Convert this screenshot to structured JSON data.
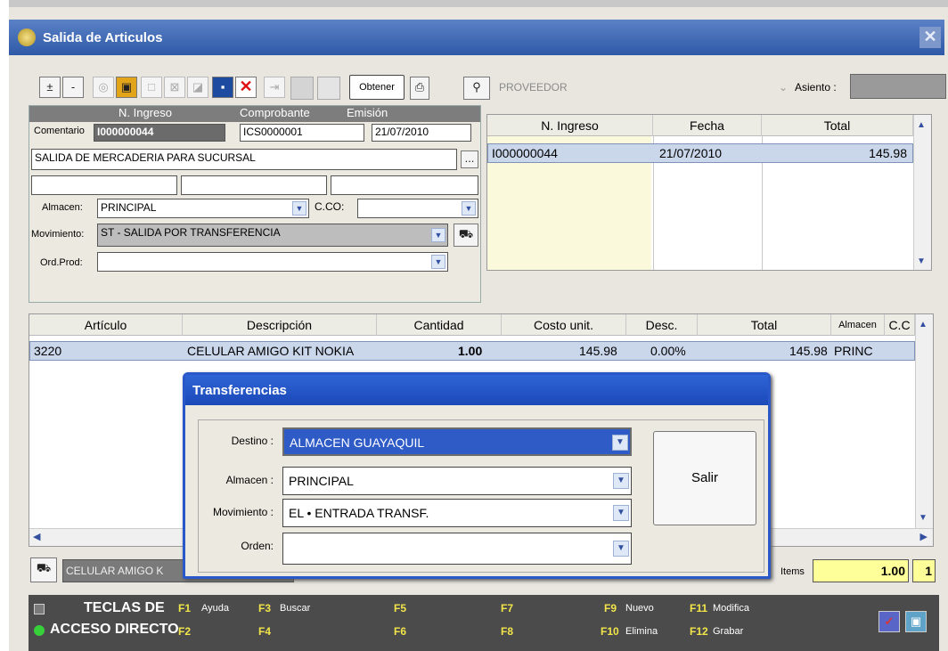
{
  "window": {
    "title": "Salida de Articulos",
    "close_glyph": "✕"
  },
  "toolbar": {
    "obtener_label": "Obtener",
    "proveedor_placeholder": "PROVEEDOR",
    "asiento_label": "Asiento :"
  },
  "header_form": {
    "col1": "N. Ingreso",
    "col2": "Comprobante",
    "col3": "Emisión",
    "comentario_label": "Comentario",
    "n_ingreso": "I000000044",
    "comprobante": "ICS0000001",
    "emision": "21/07/2010",
    "descripcion": "SALIDA DE MERCADERIA PARA SUCURSAL",
    "ellipsis": "...",
    "almacen_label": "Almacen:",
    "almacen_value": "PRINCIPAL",
    "ccos_label": "C.CO:",
    "movimiento_label": "Movimiento:",
    "movimiento_value": "ST - SALIDA POR TRANSFERENCIA",
    "ordprod_label": "Ord.Prod:"
  },
  "ingresos_grid": {
    "columns": [
      "N. Ingreso",
      "Fecha",
      "Total"
    ],
    "rows": [
      [
        "I000000044",
        "21/07/2010",
        "145.98"
      ]
    ]
  },
  "items_grid": {
    "columns": [
      "Artículo",
      "Descripción",
      "Cantidad",
      "Costo unit.",
      "Desc.",
      "Total",
      "Almacen",
      "C.C"
    ],
    "rows": [
      [
        "3220",
        "CELULAR AMIGO KIT NOKIA",
        "1.00",
        "145.98",
        "0.00%",
        "145.98",
        "PRINC",
        ""
      ]
    ]
  },
  "dialog": {
    "title": "Transferencias",
    "destino_label": "Destino :",
    "destino_value": "ALMACEN GUAYAQUIL",
    "almacen_label": "Almacen :",
    "almacen_value": "PRINCIPAL",
    "movimiento_label": "Movimiento :",
    "movimiento_value": "EL • ENTRADA TRANSF.",
    "orden_label": "Orden:",
    "salir_label": "Salir"
  },
  "footer": {
    "item_desc": "CELULAR AMIGO K",
    "items_label": "Items",
    "items_total": "1.00",
    "items_count": "1"
  },
  "shortcuts": {
    "title1": "TECLAS DE",
    "title2": "ACCESO DIRECTO",
    "keys": [
      {
        "k": "F1",
        "l": "Ayuda"
      },
      {
        "k": "F2",
        "l": ""
      },
      {
        "k": "F3",
        "l": "Buscar"
      },
      {
        "k": "F4",
        "l": ""
      },
      {
        "k": "F5",
        "l": ""
      },
      {
        "k": "F6",
        "l": ""
      },
      {
        "k": "F7",
        "l": ""
      },
      {
        "k": "F8",
        "l": ""
      },
      {
        "k": "F9",
        "l": "Nuevo"
      },
      {
        "k": "F10",
        "l": "Elimina"
      },
      {
        "k": "F11",
        "l": "Modifica"
      },
      {
        "k": "F12",
        "l": "Grabar"
      }
    ]
  },
  "colors": {
    "title_blue": "#2f5aa7",
    "dialog_blue": "#1b49b8",
    "selected_row": "#cad6ea",
    "yellow_total": "#ffff99"
  }
}
